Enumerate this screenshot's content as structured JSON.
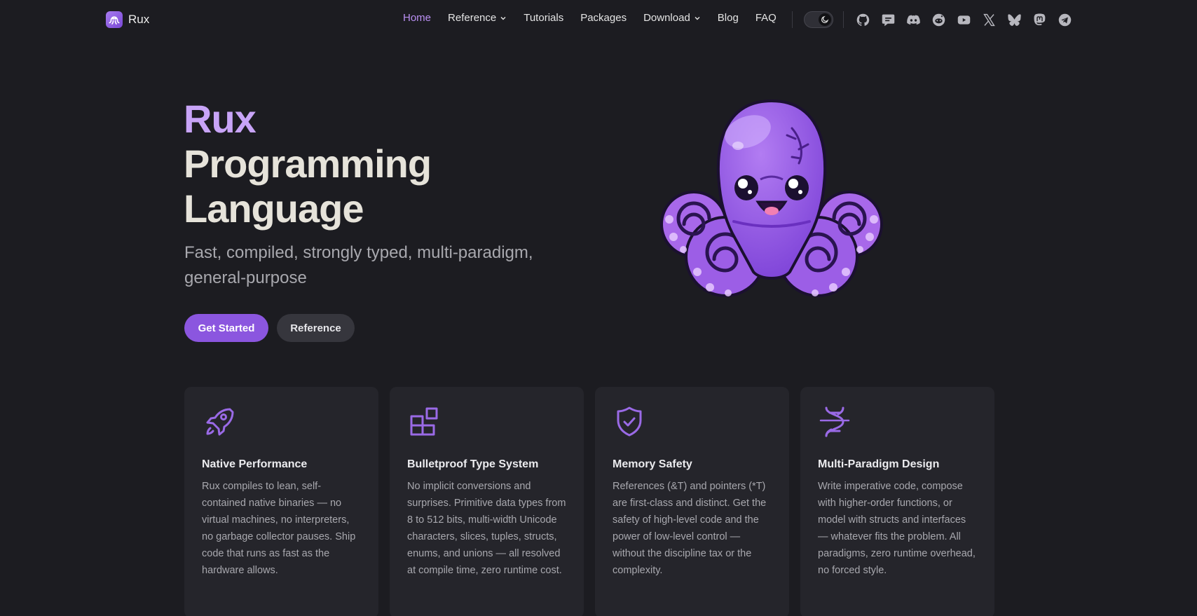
{
  "brand": {
    "name": "Rux",
    "logo_icon": "octopus-logo-icon"
  },
  "nav": {
    "items": [
      {
        "label": "Home",
        "active": true,
        "dropdown": false
      },
      {
        "label": "Reference",
        "active": false,
        "dropdown": true
      },
      {
        "label": "Tutorials",
        "active": false,
        "dropdown": false
      },
      {
        "label": "Packages",
        "active": false,
        "dropdown": false
      },
      {
        "label": "Download",
        "active": false,
        "dropdown": true
      },
      {
        "label": "Blog",
        "active": false,
        "dropdown": false
      },
      {
        "label": "FAQ",
        "active": false,
        "dropdown": false
      }
    ],
    "theme_toggle_icon": "moon-icon",
    "socials": [
      "github-icon",
      "forum-icon",
      "discord-icon",
      "reddit-icon",
      "youtube-icon",
      "x-icon",
      "bluesky-icon",
      "mastodon-icon",
      "telegram-icon"
    ]
  },
  "hero": {
    "title_accent": "Rux",
    "title_line2": "Programming",
    "title_line3": "Language",
    "subtitle": "Fast, compiled, strongly typed, multi-paradigm, general-purpose",
    "primary_button": "Get Started",
    "secondary_button": "Reference",
    "mascot": "octopus-mascot"
  },
  "features": [
    {
      "icon": "rocket-icon",
      "title": "Native Performance",
      "text": "Rux compiles to lean, self-contained native binaries — no virtual machines, no interpreters, no garbage collector pauses. Ship code that runs as fast as the hardware allows."
    },
    {
      "icon": "blocks-icon",
      "title": "Bulletproof Type System",
      "text": "No implicit conversions and surprises. Primitive data types from 8 to 512 bits, multi-width Unicode characters, slices, tuples, structs, enums, and unions — all resolved at compile time, zero runtime cost."
    },
    {
      "icon": "shield-check-icon",
      "title": "Memory Safety",
      "text": "References (&T) and pointers (*T) are first-class and distinct. Get the safety of high-level code and the power of low-level control — without the discipline tax or the complexity."
    },
    {
      "icon": "dna-icon",
      "title": "Multi-Paradigm Design",
      "text": "Write imperative code, compose with higher-order functions, or model with structs and interfaces — whatever fits the problem. All paradigms, zero runtime overhead, no forced style."
    }
  ],
  "colors": {
    "background": "#1c1c21",
    "accent": "#8b56df",
    "accent_light": "#c8a4f7",
    "card": "#25252b"
  }
}
